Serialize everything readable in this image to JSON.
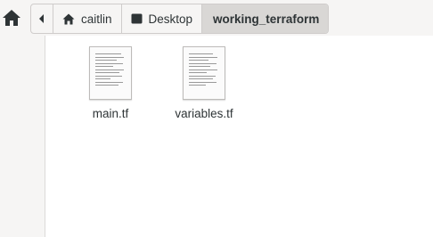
{
  "toolbar": {
    "home_icon": "home-icon",
    "back_icon": "chevron-left-icon"
  },
  "breadcrumb": {
    "items": [
      {
        "label": "caitlin",
        "icon": "home-icon"
      },
      {
        "label": "Desktop",
        "icon": "desktop-icon"
      },
      {
        "label": "working_terraform"
      }
    ]
  },
  "files": [
    {
      "name": "main.tf",
      "icon": "text-document-icon"
    },
    {
      "name": "variables.tf",
      "icon": "text-document-icon"
    }
  ],
  "colors": {
    "toolbar_bg": "#f6f5f4",
    "current_crumb_bg": "#d9d7d5",
    "text": "#2e3436"
  }
}
